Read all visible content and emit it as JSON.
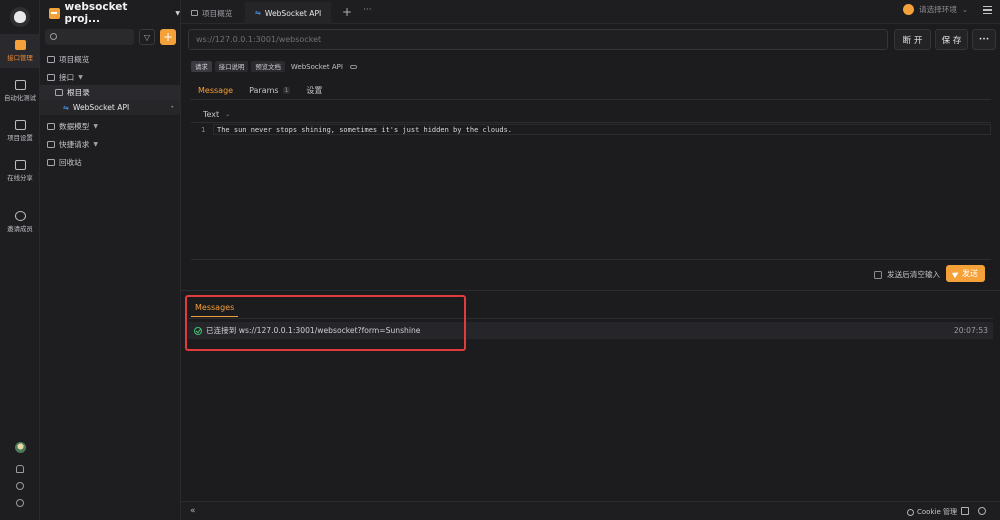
{
  "rail": {
    "items": [
      {
        "label": "接口管理",
        "icon": "api-icon",
        "active": true
      },
      {
        "label": "自动化测试",
        "icon": "automation-icon"
      },
      {
        "label": "项目设置",
        "icon": "settings-icon"
      },
      {
        "label": "在线分享",
        "icon": "share-icon"
      },
      {
        "label": "邀请成员",
        "icon": "invite-icon"
      }
    ]
  },
  "sidebar": {
    "project_name": "websocket proj...",
    "tree": [
      {
        "label": "项目概览",
        "icon": "overview-icon"
      },
      {
        "label": "接口",
        "icon": "api-folder-icon"
      },
      {
        "label": "根目录",
        "icon": "folder-icon"
      },
      {
        "label": "WebSocket API",
        "icon": "websocket-icon"
      },
      {
        "label": "数据模型",
        "icon": "model-icon"
      },
      {
        "label": "快捷请求",
        "icon": "quick-request-icon"
      },
      {
        "label": "回收站",
        "icon": "trash-icon"
      }
    ]
  },
  "tabs": [
    {
      "label": "项目概览"
    },
    {
      "label": "WebSocket API"
    }
  ],
  "env": {
    "placeholder": "请选择环境"
  },
  "request": {
    "url_placeholder": "ws://127.0.0.1:3001/websocket",
    "connect_label": "断 开",
    "save_label": "保 存",
    "more_label": "•••",
    "subtabs": [
      "请求",
      "接口说明",
      "预览文档"
    ],
    "doc_name": "WebSocket API",
    "tabs": [
      {
        "label": "Message"
      },
      {
        "label": "Params",
        "count": "1"
      },
      {
        "label": "设置"
      }
    ],
    "format": "Text",
    "line_number": "1",
    "body": "The sun never stops shining, sometimes it's just hidden by the clouds.",
    "clear_after_send": "发送后清空输入",
    "send_label": "发送"
  },
  "messages": {
    "tab_label": "Messages",
    "items": [
      {
        "text": "已连接到 ws://127.0.0.1:3001/websocket?form=Sunshine",
        "time": "20:07:53"
      }
    ]
  },
  "status": {
    "cookie_label": "Cookie 管理"
  },
  "colors": {
    "accent": "#f5a13a",
    "success": "#3fbf6f",
    "highlight": "#e23b3b"
  }
}
